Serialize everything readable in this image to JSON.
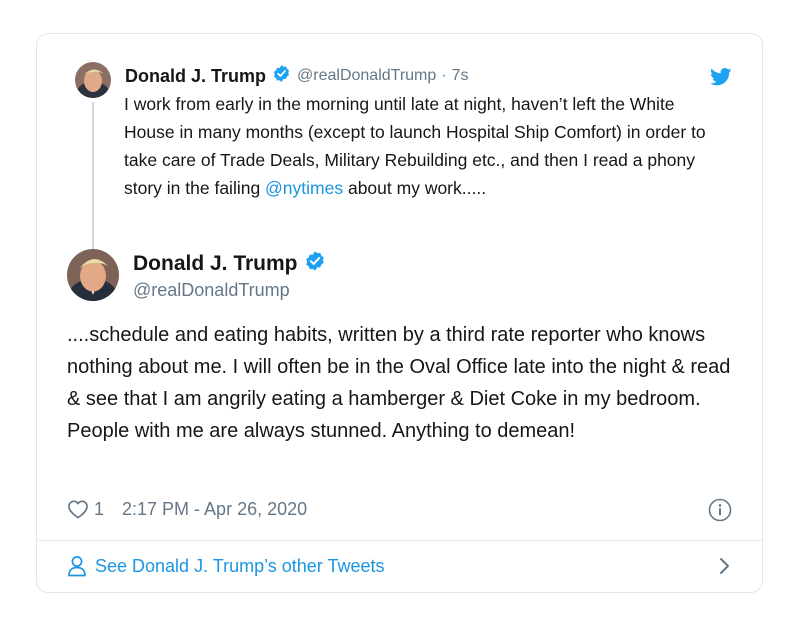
{
  "parent_tweet": {
    "display_name": "Donald J. Trump",
    "handle": "@realDonaldTrump",
    "separator": "·",
    "time_ago": "7s",
    "text_before_mention": "I work from early in the morning until late at night, haven’t left the White House in many months (except to launch Hospital Ship Comfort) in order to take care of Trade Deals, Military Rebuilding etc., and then I read a phony story in the failing ",
    "mention": "@nytimes",
    "text_after_mention": " about my work....."
  },
  "main_tweet": {
    "display_name": "Donald J. Trump",
    "handle": "@realDonaldTrump",
    "text": "....schedule and eating habits, written by a third rate reporter who knows nothing about me. I will often be in the Oval Office late into the night & read & see that I am angrily eating a hamberger & Diet Coke in my bedroom. People with me are always stunned. Anything to demean!",
    "like_count": "1",
    "timestamp": "2:17 PM - Apr 26, 2020"
  },
  "footer": {
    "label": "See Donald J. Trump’s other Tweets"
  },
  "icons": {
    "verified": "verified-badge-icon",
    "brand": "twitter-bird-icon",
    "like": "heart-icon",
    "info": "info-icon",
    "person": "person-icon",
    "chevron": "chevron-right-icon"
  },
  "colors": {
    "accent": "#1da1f2",
    "link": "#1b95e0",
    "secondary_text": "#657786",
    "border": "#e1e8ed"
  }
}
